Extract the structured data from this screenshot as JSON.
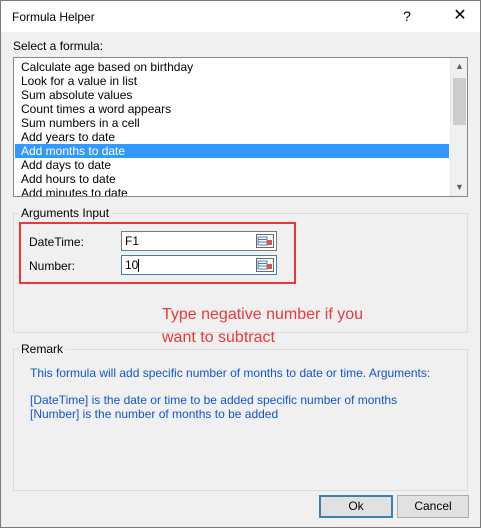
{
  "window": {
    "title": "Formula Helper",
    "help_glyph": "?",
    "close_glyph": "✕"
  },
  "formula_list": {
    "label": "Select a formula:",
    "items": [
      "Calculate age based on birthday",
      "Look for a value in list",
      "Sum absolute values",
      "Count times a word appears",
      "Sum numbers in a cell",
      "Add years to date",
      "Add months to date",
      "Add days to date",
      "Add hours to date",
      "Add minutes to date"
    ],
    "selected_index": 6
  },
  "arguments": {
    "group_label": "Arguments Input",
    "datetime": {
      "label": "DateTime:",
      "value": "F1"
    },
    "number": {
      "label": "Number:",
      "value": "10"
    }
  },
  "annotation": {
    "line1": "Type negative number if you",
    "line2": "want to subtract",
    "color": "#e8383d"
  },
  "remark": {
    "group_label": "Remark",
    "line1": "This formula will add specific number of months to date or time. Arguments:",
    "line2": "[DateTime] is the date or time to be added specific number of months",
    "line3": "[Number] is the number of months to be added",
    "color": "#1155cc"
  },
  "buttons": {
    "ok": "Ok",
    "cancel": "Cancel"
  }
}
